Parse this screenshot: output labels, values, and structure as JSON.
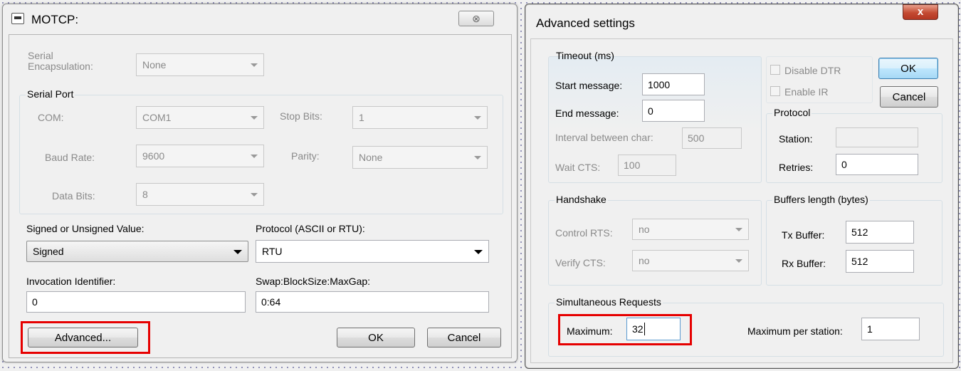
{
  "left_dialog": {
    "title": "MOTCP:",
    "close_glyph": "⊗",
    "serial_encapsulation": {
      "label_line1": "Serial",
      "label_line2": "Encapsulation:",
      "value": "None"
    },
    "serial_port": {
      "group_title": "Serial Port",
      "com_label": "COM:",
      "com_value": "COM1",
      "stop_bits_label": "Stop Bits:",
      "stop_bits_value": "1",
      "baud_rate_label": "Baud Rate:",
      "baud_rate_value": "9600",
      "parity_label": "Parity:",
      "parity_value": "None",
      "data_bits_label": "Data Bits:",
      "data_bits_value": "8"
    },
    "signed_label": "Signed or Unsigned Value:",
    "signed_value": "Signed",
    "protocol_label": "Protocol (ASCII or RTU):",
    "protocol_value": "RTU",
    "invocation_label": "Invocation Identifier:",
    "invocation_value": "0",
    "swap_label": "Swap:BlockSize:MaxGap:",
    "swap_value": "0:64",
    "advanced_button": "Advanced...",
    "ok_button": "OK",
    "cancel_button": "Cancel"
  },
  "right_dialog": {
    "title": "Advanced settings",
    "close_glyph": "x",
    "timeout": {
      "group_title": "Timeout (ms)",
      "start_label": "Start message:",
      "start_value": "1000",
      "end_label": "End message:",
      "end_value": "0",
      "interval_label": "Interval between char:",
      "interval_value": "500",
      "wait_cts_label": "Wait CTS:",
      "wait_cts_value": "100"
    },
    "disable_dtr_label": "Disable DTR",
    "enable_ir_label": "Enable IR",
    "ok_button": "OK",
    "cancel_button": "Cancel",
    "protocol": {
      "group_title": "Protocol",
      "station_label": "Station:",
      "station_value": "",
      "retries_label": "Retries:",
      "retries_value": "0"
    },
    "handshake": {
      "group_title": "Handshake",
      "control_rts_label": "Control RTS:",
      "control_rts_value": "no",
      "verify_cts_label": "Verify CTS:",
      "verify_cts_value": "no"
    },
    "buffers": {
      "group_title": "Buffers length (bytes)",
      "tx_label": "Tx Buffer:",
      "tx_value": "512",
      "rx_label": "Rx Buffer:",
      "rx_value": "512"
    },
    "simultaneous": {
      "group_title": "Simultaneous Requests",
      "maximum_label": "Maximum:",
      "maximum_value": "32",
      "per_station_label": "Maximum per station:",
      "per_station_value": "1"
    }
  },
  "colors": {
    "highlight": "#e60000",
    "close_red": "#c44a32"
  }
}
